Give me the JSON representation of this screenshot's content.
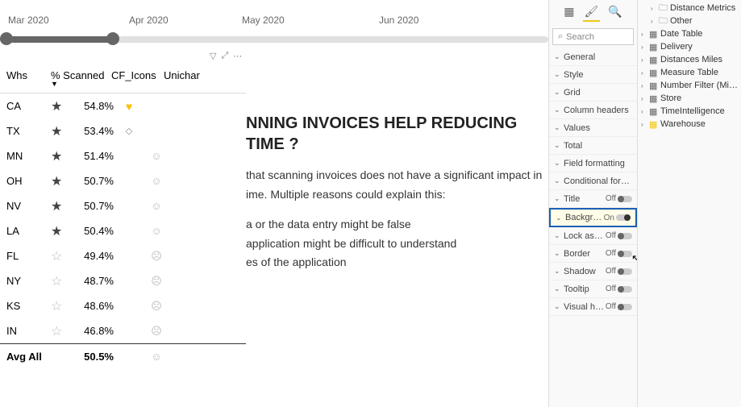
{
  "timeline": {
    "labels": [
      "Mar 2020",
      "Apr 2020",
      "May 2020",
      "Jun 2020"
    ]
  },
  "table": {
    "headers": {
      "whs": "Whs",
      "scanned": "% Scanned",
      "cf": "CF_Icons",
      "unichar": "Unichar"
    },
    "rows": [
      {
        "whs": "CA",
        "star": "full",
        "pct": "54.8%",
        "cf": "heart",
        "uni": ""
      },
      {
        "whs": "TX",
        "star": "full",
        "pct": "53.4%",
        "cf": "diamond",
        "uni": ""
      },
      {
        "whs": "MN",
        "star": "half",
        "pct": "51.4%",
        "cf": "",
        "uni": "neutral"
      },
      {
        "whs": "OH",
        "star": "half",
        "pct": "50.7%",
        "cf": "",
        "uni": "neutral"
      },
      {
        "whs": "NV",
        "star": "half",
        "pct": "50.7%",
        "cf": "",
        "uni": "neutral"
      },
      {
        "whs": "LA",
        "star": "half",
        "pct": "50.4%",
        "cf": "",
        "uni": "neutral"
      },
      {
        "whs": "FL",
        "star": "empty",
        "pct": "49.4%",
        "cf": "",
        "uni": "sad"
      },
      {
        "whs": "NY",
        "star": "empty",
        "pct": "48.7%",
        "cf": "",
        "uni": "sad"
      },
      {
        "whs": "KS",
        "star": "empty",
        "pct": "48.6%",
        "cf": "",
        "uni": "sad"
      },
      {
        "whs": "IN",
        "star": "empty",
        "pct": "46.8%",
        "cf": "",
        "uni": "sad"
      }
    ],
    "avg": {
      "label": "Avg All",
      "pct": "50.5%",
      "uni": "neutral"
    }
  },
  "text": {
    "title_1": "NNING INVOICES HELP REDUCING",
    "title_2": "TIME ?",
    "para1": "that scanning invoices does not have a significant impact in",
    "para2": "ime. Multiple reasons could explain this:",
    "bullet1": "a or the data entry might be false",
    "bullet2": "application might be difficult to understand",
    "bullet3": "es of the application"
  },
  "format": {
    "search_placeholder": "Search",
    "groups": {
      "general": "General",
      "style": "Style",
      "grid": "Grid",
      "column_headers": "Column headers",
      "values": "Values",
      "total": "Total",
      "field_formatting": "Field formatting",
      "conditional_formatting": "Conditional formatting",
      "title": "Title",
      "background": "Backgro...",
      "lock_aspect": "Lock asp...",
      "border": "Border",
      "shadow": "Shadow",
      "tooltip": "Tooltip",
      "visual_header": "Visual he..."
    },
    "toggles": {
      "title": "Off",
      "background": "On",
      "lock_aspect": "Off",
      "border": "Off",
      "shadow": "Off",
      "tooltip": "Off",
      "visual_header": "Off"
    }
  },
  "fields": {
    "items": [
      {
        "label": "Distance Metrics",
        "icon": "folder",
        "indent": true
      },
      {
        "label": "Other",
        "icon": "folder",
        "indent": true
      },
      {
        "label": "Date Table",
        "icon": "table",
        "indent": false
      },
      {
        "label": "Delivery",
        "icon": "table",
        "indent": false
      },
      {
        "label": "Distances Miles",
        "icon": "table",
        "indent": false
      },
      {
        "label": "Measure Table",
        "icon": "table",
        "indent": false
      },
      {
        "label": "Number Filter (Miles)",
        "icon": "table",
        "indent": false
      },
      {
        "label": "Store",
        "icon": "table",
        "indent": false
      },
      {
        "label": "TimeIntelligence",
        "icon": "table",
        "indent": false
      },
      {
        "label": "Warehouse",
        "icon": "table-warn",
        "indent": false
      }
    ]
  }
}
